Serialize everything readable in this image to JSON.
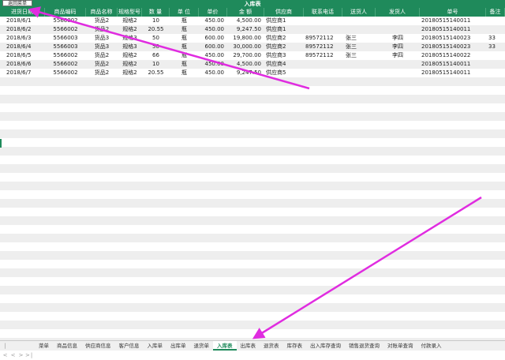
{
  "toolbar": {
    "back_label": "返回菜单",
    "sheet_title": "入库表"
  },
  "columns": [
    "进货日期",
    "商品编码",
    "商品名称",
    "规格型号",
    "数    量",
    "单    位",
    "单价",
    "金    额",
    "供应商",
    "联系电话",
    "送货人",
    "发货人",
    "单号",
    "备注"
  ],
  "rows": [
    [
      "2018/6/1",
      "5566002",
      "货品2",
      "规格2",
      "10",
      "瓶",
      "450.00",
      "4,500.00",
      "供应商1",
      "",
      "",
      "",
      "20180515140011",
      ""
    ],
    [
      "2018/6/2",
      "5566002",
      "货品2",
      "规格2",
      "20.55",
      "瓶",
      "450.00",
      "9,247.50",
      "供应商1",
      "",
      "",
      "",
      "20180515140011",
      ""
    ],
    [
      "2018/6/3",
      "5566003",
      "货品3",
      "规格3",
      "50",
      "瓶",
      "600.00",
      "19,800.00",
      "供应商2",
      "89572112",
      "张三",
      "李四",
      "20180515140023",
      "33"
    ],
    [
      "2018/6/4",
      "5566003",
      "货品3",
      "规格3",
      "50",
      "瓶",
      "600.00",
      "30,000.00",
      "供应商2",
      "89572112",
      "张三",
      "李四",
      "20180515140023",
      "33"
    ],
    [
      "2018/6/5",
      "5566002",
      "货品2",
      "规格2",
      "66",
      "瓶",
      "450.00",
      "29,700.00",
      "供应商3",
      "89572112",
      "张三",
      "李四",
      "20180515140022",
      ""
    ],
    [
      "2018/6/6",
      "5566002",
      "货品2",
      "规格2",
      "10",
      "瓶",
      "450.00",
      "4,500.00",
      "供应商4",
      "",
      "",
      "",
      "20180515140011",
      ""
    ],
    [
      "2018/6/7",
      "5566002",
      "货品2",
      "规格2",
      "20.55",
      "瓶",
      "450.00",
      "9,247.50",
      "供应商5",
      "",
      "",
      "",
      "20180515140011",
      ""
    ]
  ],
  "tabs": [
    "菜单",
    "商品信息",
    "供应商信息",
    "客户信息",
    "入库单",
    "出库单",
    "退货单",
    "入库表",
    "出库表",
    "退货表",
    "库存表",
    "出入库存查询",
    "销售退货查询",
    "对账单查询",
    "付款录入"
  ],
  "active_tab": "入库表",
  "colors": {
    "header_green": "#1f8a5b",
    "row_stripe": "#eeeeee",
    "annotation_arrow": "#e02ce0"
  }
}
